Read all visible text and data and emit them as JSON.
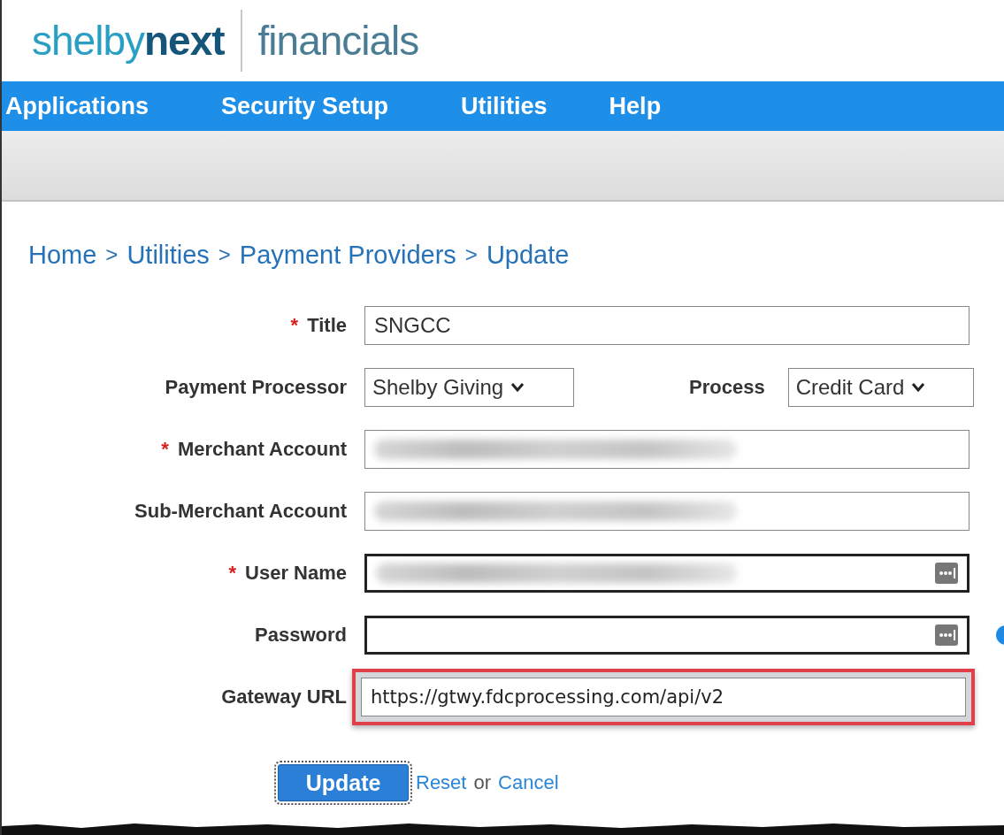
{
  "logo": {
    "brand_light": "shelby",
    "brand_bold": "next",
    "product": "financials"
  },
  "nav": [
    "Applications",
    "Security Setup",
    "Utilities",
    "Help"
  ],
  "breadcrumb": [
    "Home",
    "Utilities",
    "Payment Providers",
    "Update"
  ],
  "breadcrumb_separator": ">",
  "required_mark": "*",
  "form": [
    {
      "kind": "text",
      "label": "Title",
      "required": true,
      "value": "SNGCC"
    },
    {
      "kind": "selects",
      "label": "Payment Processor",
      "required": false,
      "value": "Shelby Giving",
      "second_label": "Process",
      "second_value": "Credit Card"
    },
    {
      "kind": "text",
      "label": "Merchant Account",
      "required": true,
      "blurred": true
    },
    {
      "kind": "text",
      "label": "Sub-Merchant Account",
      "required": false,
      "blurred": true
    },
    {
      "kind": "secret",
      "label": "User Name",
      "required": true,
      "blurred": true
    },
    {
      "kind": "secret",
      "label": "Password",
      "required": false,
      "blurred": false,
      "info": true
    },
    {
      "kind": "text",
      "label": "Gateway URL",
      "required": false,
      "value": "https://gtwy.fdcprocessing.com/api/v2",
      "highlighted": true
    }
  ],
  "actions": {
    "submit": "Update",
    "reset": "Reset",
    "joiner": "or",
    "cancel": "Cancel"
  }
}
